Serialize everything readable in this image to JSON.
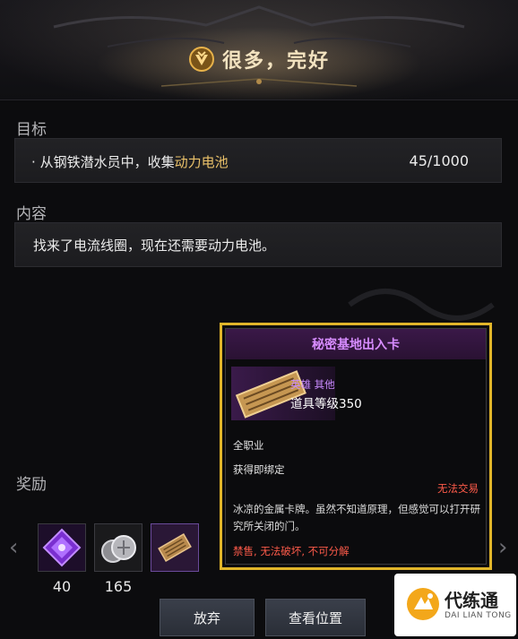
{
  "header": {
    "title": "很多，完好",
    "icon": "quest-emblem-icon"
  },
  "objective": {
    "label": "目标",
    "bullet": "·",
    "text_prefix": "从钢铁潜水员中，收集",
    "text_highlight": "动力电池",
    "progress": "45/1000"
  },
  "content": {
    "label": "内容",
    "text": "找来了电流线圈，现在还需要动力电池。"
  },
  "rewards": {
    "label": "奖励",
    "items": [
      {
        "icon": "purple-crystal-icon",
        "count": "40"
      },
      {
        "icon": "silver-coins-icon",
        "count": "165"
      },
      {
        "icon": "access-card-icon",
        "count": ""
      }
    ]
  },
  "buttons": {
    "abandon": "放弃",
    "view_location": "查看位置"
  },
  "tooltip": {
    "title": "秘密基地出入卡",
    "grade": "英雄 其他",
    "item_level": "道具等级350",
    "class": "全职业",
    "binding": "获得即绑定",
    "trade": "无法交易",
    "description_line1": "冰凉的金属卡牌。虽然不知道原理，但感觉可以打开研",
    "description_line2": "究所关闭的门。",
    "restriction_1": "禁售",
    "restriction_sep": ", ",
    "restriction_2": "无法破坏",
    "restriction_3": "不可分解"
  },
  "watermark": {
    "brand": "代练通",
    "brand_sub": "DAI LIAN TONG"
  },
  "colors": {
    "gold_highlight": "#ebc26a",
    "tooltip_border": "#e1b52a",
    "tooltip_title": "#d78cff",
    "warning_red": "#ff5b4a"
  }
}
